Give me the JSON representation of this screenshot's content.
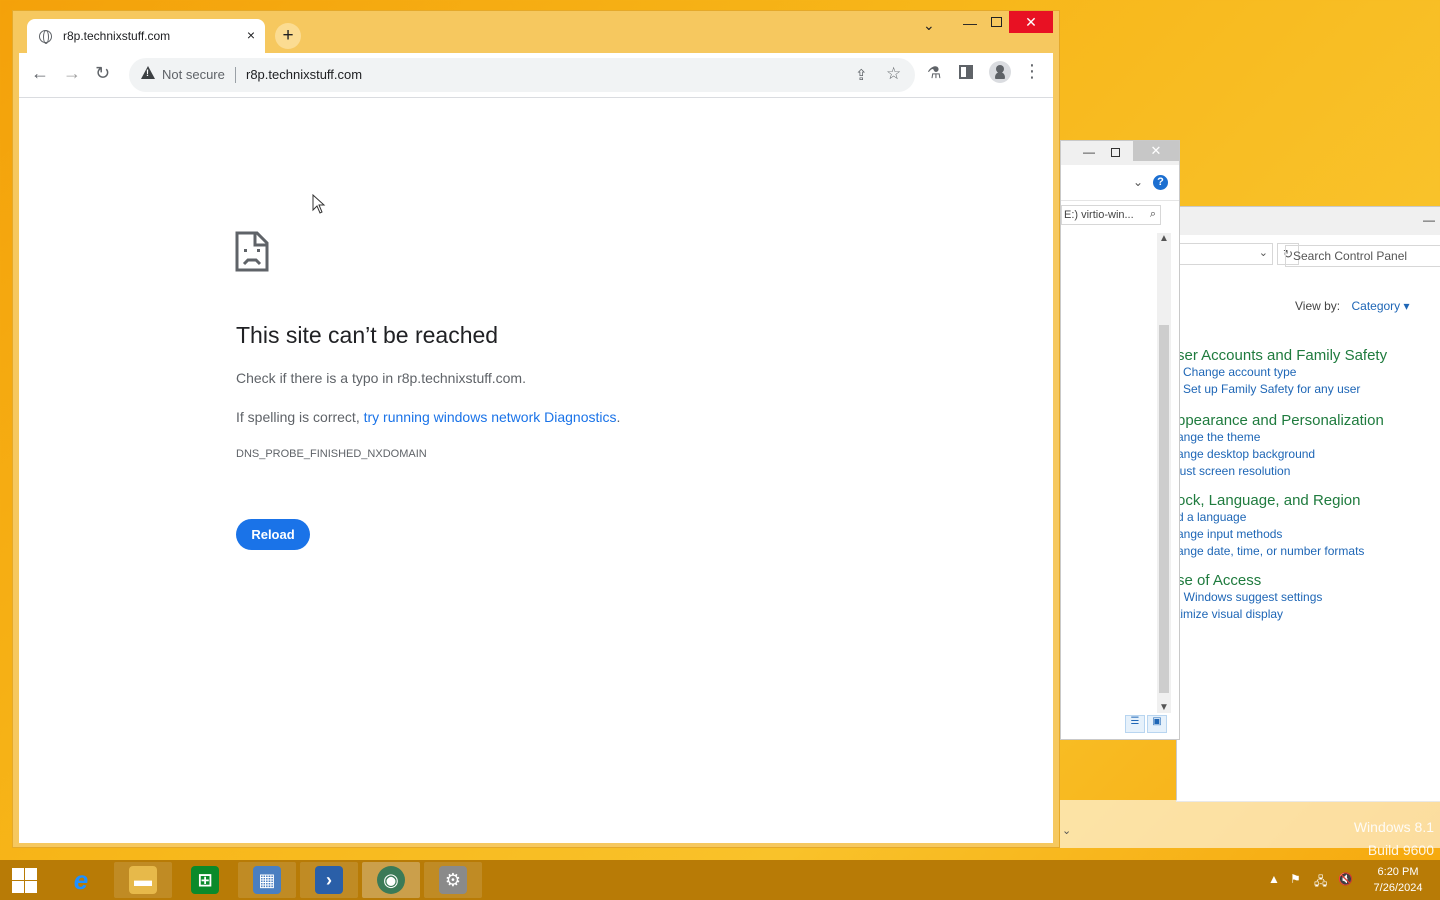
{
  "browser": {
    "tab_title": "r8p.technixstuff.com",
    "tab_close": "×",
    "new_tab": "+",
    "security_label": "Not secure",
    "url": "r8p.technixstuff.com",
    "window_buttons": {
      "dropdown": "⌄",
      "minimize": "—",
      "close": "✕"
    }
  },
  "error_page": {
    "title": "This site can’t be reached",
    "line1": "Check if there is a typo in r8p.technixstuff.com.",
    "line2_prefix": "If spelling is correct, ",
    "line2_link": "try running windows network Diagnostics",
    "line2_suffix": ".",
    "code": "DNS_PROBE_FINISHED_NXDOMAIN",
    "reload_label": "Reload"
  },
  "explorer": {
    "search_text": "E:) virtio-win...",
    "close": "✕",
    "minimize": "—",
    "help": "?"
  },
  "control_panel": {
    "search_placeholder": "Search Control Panel",
    "view_by_label": "View by:",
    "view_by_value": "Category",
    "minimize": "—",
    "sections": [
      {
        "heading": "ser Accounts and Family Safety",
        "links": [
          "Change account type",
          "Set up Family Safety for any user"
        ]
      },
      {
        "heading": "ppearance and Personalization",
        "links": [
          "ange the theme",
          "ange desktop background",
          "just screen resolution"
        ]
      },
      {
        "heading": "ock, Language, and Region",
        "links": [
          "d a language",
          "ange input methods",
          "ange date, time, or number formats"
        ]
      },
      {
        "heading": "se of Access",
        "links": [
          ": Windows suggest settings",
          "timize visual display"
        ]
      }
    ]
  },
  "desktop": {
    "watermark_line1": "Windows 8.1",
    "watermark_line2": "Build 9600"
  },
  "taskbar": {
    "apps": [
      {
        "name": "internet-explorer",
        "glyph": "e",
        "color": "#1e90ff"
      },
      {
        "name": "file-explorer",
        "glyph": "▬",
        "color": "#e7b94a"
      },
      {
        "name": "store",
        "glyph": "⊞",
        "color": "#0a8a2a"
      },
      {
        "name": "server-manager",
        "glyph": "▦",
        "color": "#4a7fc1"
      },
      {
        "name": "powershell",
        "glyph": "›",
        "color": "#2a5fa8"
      },
      {
        "name": "chrome",
        "glyph": "◉",
        "color": "#3b7a57"
      },
      {
        "name": "setup-tool",
        "glyph": "⚙",
        "color": "#8a8a8a"
      }
    ],
    "time": "6:20 PM",
    "date": "7/26/2024",
    "tray": [
      "▲",
      "⚑",
      "🖧",
      "🔇"
    ]
  },
  "colors": {
    "chrome_frame": "#f6c85f",
    "link_blue": "#1a73e8",
    "cp_green": "#1f7b3e",
    "cp_link": "#1e66b6",
    "taskbar": "#b87b06"
  }
}
